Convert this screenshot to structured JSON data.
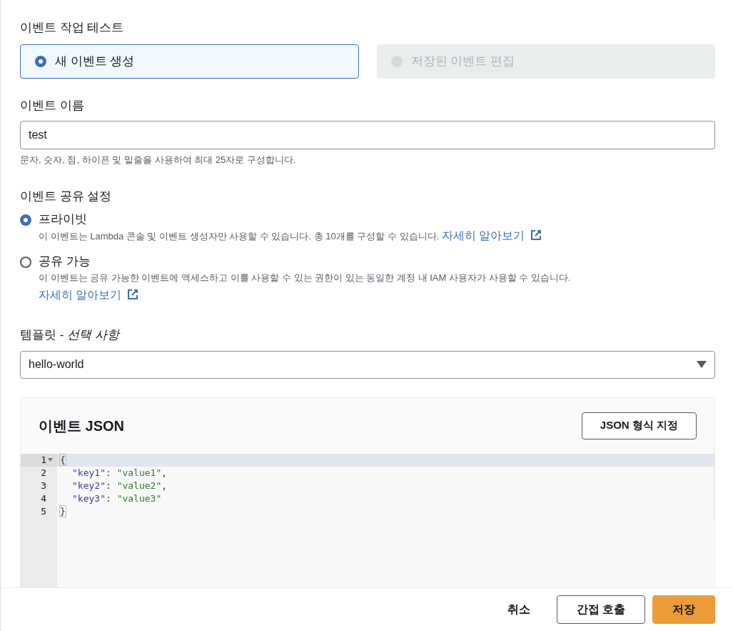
{
  "title": "이벤트 작업 테스트",
  "action_tiles": [
    {
      "label": "새 이벤트 생성",
      "selected": true,
      "disabled": false
    },
    {
      "label": "저장된 이벤트 편집",
      "selected": false,
      "disabled": true
    }
  ],
  "event_name": {
    "label": "이벤트 이름",
    "value": "test",
    "hint": "문자, 숫자, 점, 하이픈 및 밑줄을 사용하여 최대 25자로 구성합니다."
  },
  "sharing": {
    "label": "이벤트 공유 설정",
    "options": [
      {
        "label": "프라이빗",
        "selected": true,
        "description": "이 이벤트는 Lambda 콘솔 및 이벤트 생성자만 사용할 수 있습니다. 총 10개를 구성할 수 있습니다.",
        "link": "자세히 알아보기"
      },
      {
        "label": "공유 가능",
        "selected": false,
        "description": "이 이벤트는 공유 가능한 이벤트에 액세스하고 이를 사용할 수 있는 권한이 있는 동일한 계정 내 IAM 사용자가 사용할 수 있습니다.",
        "link": "자세히 알아보기"
      }
    ]
  },
  "template": {
    "label": "템플릿 - ",
    "label_optional": "선택 사항",
    "value": "hello-world"
  },
  "event_json": {
    "title": "이벤트 JSON",
    "format_button": "JSON 형식 지정",
    "lines": [
      {
        "number": "1",
        "fold": true,
        "active": true,
        "tokens": [
          {
            "kind": "brace",
            "text": "{"
          }
        ]
      },
      {
        "number": "2",
        "fold": false,
        "active": false,
        "tokens": [
          {
            "kind": "key",
            "text": "\"key1\""
          },
          {
            "kind": "punct",
            "text": ": "
          },
          {
            "kind": "string",
            "text": "\"value1\""
          },
          {
            "kind": "punct",
            "text": ","
          }
        ]
      },
      {
        "number": "3",
        "fold": false,
        "active": false,
        "tokens": [
          {
            "kind": "key",
            "text": "\"key2\""
          },
          {
            "kind": "punct",
            "text": ": "
          },
          {
            "kind": "string",
            "text": "\"value2\""
          },
          {
            "kind": "punct",
            "text": ","
          }
        ]
      },
      {
        "number": "4",
        "fold": false,
        "active": false,
        "tokens": [
          {
            "kind": "key",
            "text": "\"key3\""
          },
          {
            "kind": "punct",
            "text": ": "
          },
          {
            "kind": "string",
            "text": "\"value3\""
          }
        ]
      },
      {
        "number": "5",
        "fold": false,
        "active": false,
        "tokens": [
          {
            "kind": "brace",
            "text": "}"
          }
        ]
      }
    ]
  },
  "footer": {
    "buttons": [
      {
        "label": "취소",
        "kind": "link"
      },
      {
        "label": "간접 호출",
        "kind": "normal"
      },
      {
        "label": "저장",
        "kind": "primary"
      }
    ]
  }
}
